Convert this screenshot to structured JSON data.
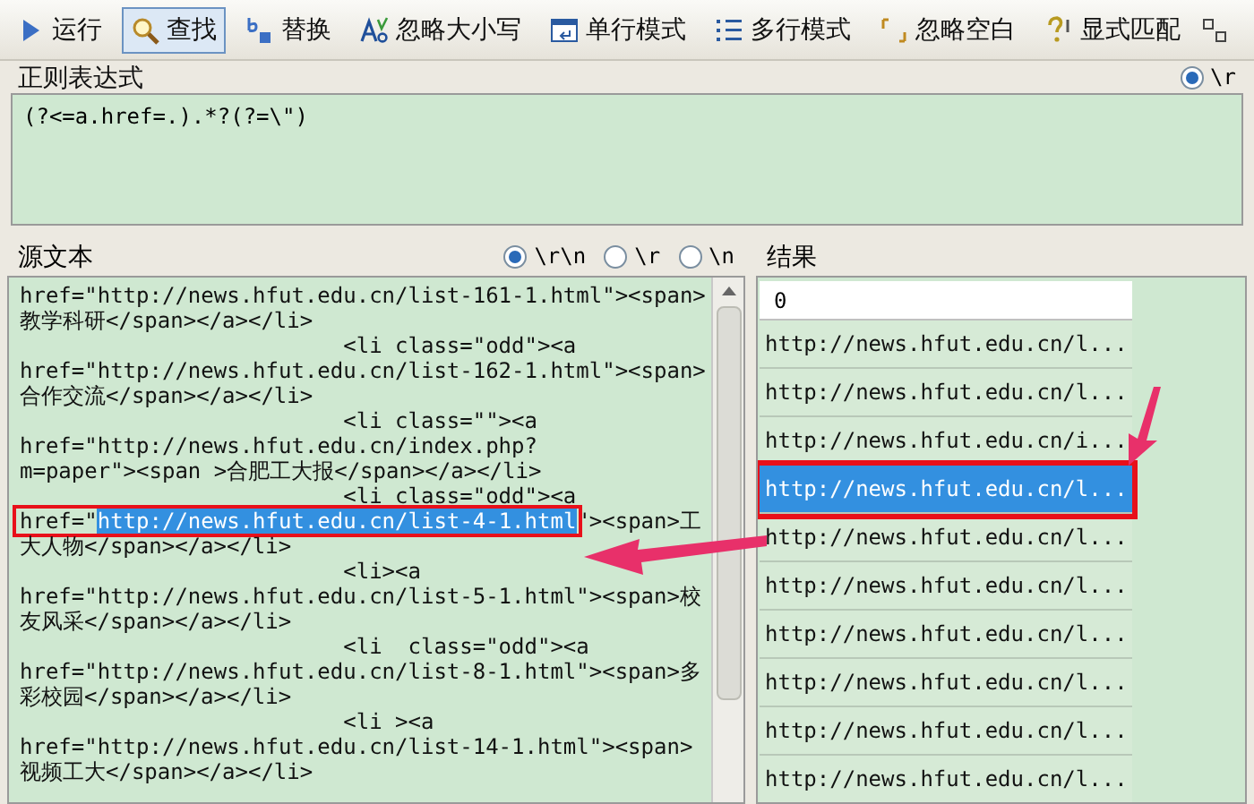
{
  "toolbar": [
    {
      "label": "运行",
      "selected": false
    },
    {
      "label": "查找",
      "selected": true
    },
    {
      "label": "替换",
      "selected": false
    },
    {
      "label": "忽略大小写",
      "selected": false
    },
    {
      "label": "单行模式",
      "selected": false
    },
    {
      "label": "多行模式",
      "selected": false
    },
    {
      "label": "忽略空白",
      "selected": false
    },
    {
      "label": "显式匹配",
      "selected": false
    }
  ],
  "regex": {
    "label": "正则表达式",
    "option": {
      "label": "\\r",
      "selected": true
    },
    "value": "(?<=a.href=.).*?(?=\\\")"
  },
  "source": {
    "label": "源文本",
    "line_endings": [
      {
        "label": "\\r\\n",
        "selected": true
      },
      {
        "label": "\\r",
        "selected": false
      },
      {
        "label": "\\n",
        "selected": false
      }
    ],
    "lines": [
      {
        "parts": [
          {
            "text": "href=\"http://news.hfut.edu.cn/list-161-1.html\"><span>",
            "selected": false
          }
        ]
      },
      {
        "parts": [
          {
            "text": "教学科研</span></a></li>",
            "selected": false
          }
        ]
      },
      {
        "parts": [
          {
            "text": "                         <li class=\"odd\"><a",
            "selected": false
          }
        ]
      },
      {
        "parts": [
          {
            "text": "href=\"http://news.hfut.edu.cn/list-162-1.html\"><span>",
            "selected": false
          }
        ]
      },
      {
        "parts": [
          {
            "text": "合作交流</span></a></li>",
            "selected": false
          }
        ]
      },
      {
        "parts": [
          {
            "text": "                         <li class=\"\"><a",
            "selected": false
          }
        ]
      },
      {
        "parts": [
          {
            "text": "href=\"http://news.hfut.edu.cn/index.php?",
            "selected": false
          }
        ]
      },
      {
        "parts": [
          {
            "text": "m=paper\"><span >合肥工大报</span></a></li>",
            "selected": false
          }
        ]
      },
      {
        "parts": [
          {
            "text": "                         <li class=\"odd\"><a",
            "selected": false
          }
        ]
      },
      {
        "parts": [
          {
            "text": "href=\"",
            "selected": false
          },
          {
            "text": "http://news.hfut.edu.cn/list-4-1.html",
            "selected": true
          },
          {
            "text": "\"><span>工",
            "selected": false
          }
        ]
      },
      {
        "parts": [
          {
            "text": "大人物</span></a></li>",
            "selected": false
          }
        ]
      },
      {
        "parts": [
          {
            "text": "                         <li><a",
            "selected": false
          }
        ]
      },
      {
        "parts": [
          {
            "text": "href=\"http://news.hfut.edu.cn/list-5-1.html\"><span>校",
            "selected": false
          }
        ]
      },
      {
        "parts": [
          {
            "text": "友风采</span></a></li>",
            "selected": false
          }
        ]
      },
      {
        "parts": [
          {
            "text": "                         <li  class=\"odd\"><a",
            "selected": false
          }
        ]
      },
      {
        "parts": [
          {
            "text": "href=\"http://news.hfut.edu.cn/list-8-1.html\"><span>多",
            "selected": false
          }
        ]
      },
      {
        "parts": [
          {
            "text": "彩校园</span></a></li>",
            "selected": false
          }
        ]
      },
      {
        "parts": [
          {
            "text": "                         <li ><a",
            "selected": false
          }
        ]
      },
      {
        "parts": [
          {
            "text": "href=\"http://news.hfut.edu.cn/list-14-1.html\"><span>",
            "selected": false
          }
        ]
      },
      {
        "parts": [
          {
            "text": "视频工大</span></a></li>",
            "selected": false
          }
        ]
      }
    ]
  },
  "results": {
    "label": "结果",
    "count": "0",
    "rows": [
      {
        "text": "http://news.hfut.edu.cn/l...",
        "selected": false
      },
      {
        "text": "http://news.hfut.edu.cn/l...",
        "selected": false
      },
      {
        "text": "http://news.hfut.edu.cn/i...",
        "selected": false
      },
      {
        "text": "http://news.hfut.edu.cn/l...",
        "selected": true
      },
      {
        "text": "http://news.hfut.edu.cn/l...",
        "selected": false
      },
      {
        "text": "http://news.hfut.edu.cn/l...",
        "selected": false
      },
      {
        "text": "http://news.hfut.edu.cn/l...",
        "selected": false
      },
      {
        "text": "http://news.hfut.edu.cn/l...",
        "selected": false
      },
      {
        "text": "http://news.hfut.edu.cn/l...",
        "selected": false
      },
      {
        "text": "http://news.hfut.edu.cn/l...",
        "selected": false
      }
    ]
  }
}
